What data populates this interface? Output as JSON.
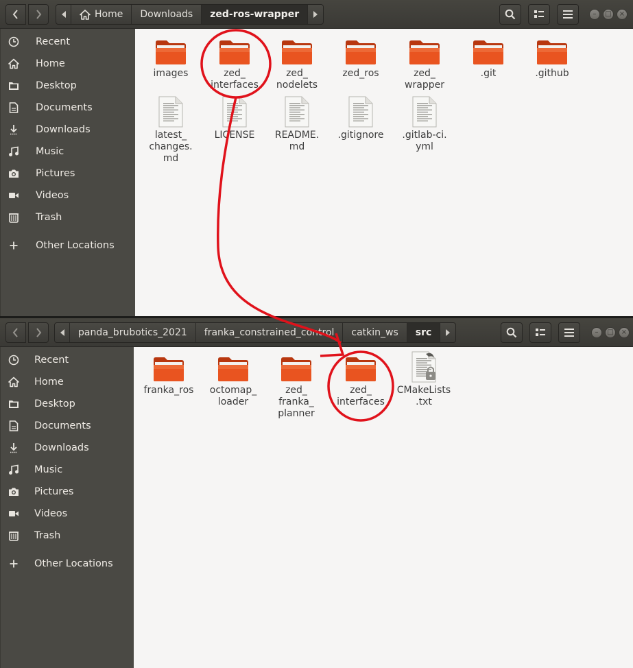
{
  "top_window": {
    "path": [
      "Home",
      "Downloads",
      "zed-ros-wrapper"
    ],
    "sidebar": [
      {
        "label": "Recent",
        "icon": "clock-icon"
      },
      {
        "label": "Home",
        "icon": "home-icon"
      },
      {
        "label": "Desktop",
        "icon": "folder-icon"
      },
      {
        "label": "Documents",
        "icon": "document-icon"
      },
      {
        "label": "Downloads",
        "icon": "download-icon"
      },
      {
        "label": "Music",
        "icon": "music-icon"
      },
      {
        "label": "Pictures",
        "icon": "camera-icon"
      },
      {
        "label": "Videos",
        "icon": "video-icon"
      },
      {
        "label": "Trash",
        "icon": "trash-icon"
      },
      {
        "label": "Other Locations",
        "icon": "plus-icon"
      }
    ],
    "files": [
      {
        "name": "images",
        "type": "folder"
      },
      {
        "name": "zed_\ninterfaces",
        "type": "folder"
      },
      {
        "name": "zed_\nnodelets",
        "type": "folder"
      },
      {
        "name": "zed_ros",
        "type": "folder"
      },
      {
        "name": "zed_\nwrapper",
        "type": "folder"
      },
      {
        "name": ".git",
        "type": "folder"
      },
      {
        "name": ".github",
        "type": "folder"
      },
      {
        "name": "latest_\nchanges.\nmd",
        "type": "text"
      },
      {
        "name": "LICENSE",
        "type": "text"
      },
      {
        "name": "README.\nmd",
        "type": "text"
      },
      {
        "name": ".gitignore",
        "type": "text"
      },
      {
        "name": ".gitlab-ci.\nyml",
        "type": "text"
      }
    ]
  },
  "bottom_window": {
    "path": [
      "panda_brubotics_2021",
      "franka_constrained_control",
      "catkin_ws",
      "src"
    ],
    "sidebar": [
      {
        "label": "Recent",
        "icon": "clock-icon"
      },
      {
        "label": "Home",
        "icon": "home-icon"
      },
      {
        "label": "Desktop",
        "icon": "folder-icon"
      },
      {
        "label": "Documents",
        "icon": "document-icon"
      },
      {
        "label": "Downloads",
        "icon": "download-icon"
      },
      {
        "label": "Music",
        "icon": "music-icon"
      },
      {
        "label": "Pictures",
        "icon": "camera-icon"
      },
      {
        "label": "Videos",
        "icon": "video-icon"
      },
      {
        "label": "Trash",
        "icon": "trash-icon"
      },
      {
        "label": "Other Locations",
        "icon": "plus-icon"
      }
    ],
    "files": [
      {
        "name": "franka_ros",
        "type": "folder"
      },
      {
        "name": "octomap_\nloader",
        "type": "folder"
      },
      {
        "name": "zed_\nfranka_\nplanner",
        "type": "folder"
      },
      {
        "name": "zed_\ninterfaces",
        "type": "folder"
      },
      {
        "name": "CMakeLists\n.txt",
        "type": "locked-text"
      }
    ]
  },
  "colors": {
    "folder": "#e95420",
    "annotation": "#e0121b",
    "titlebar": "#3c3b37",
    "sidebar": "#4a4944",
    "content": "#f6f5f4"
  }
}
